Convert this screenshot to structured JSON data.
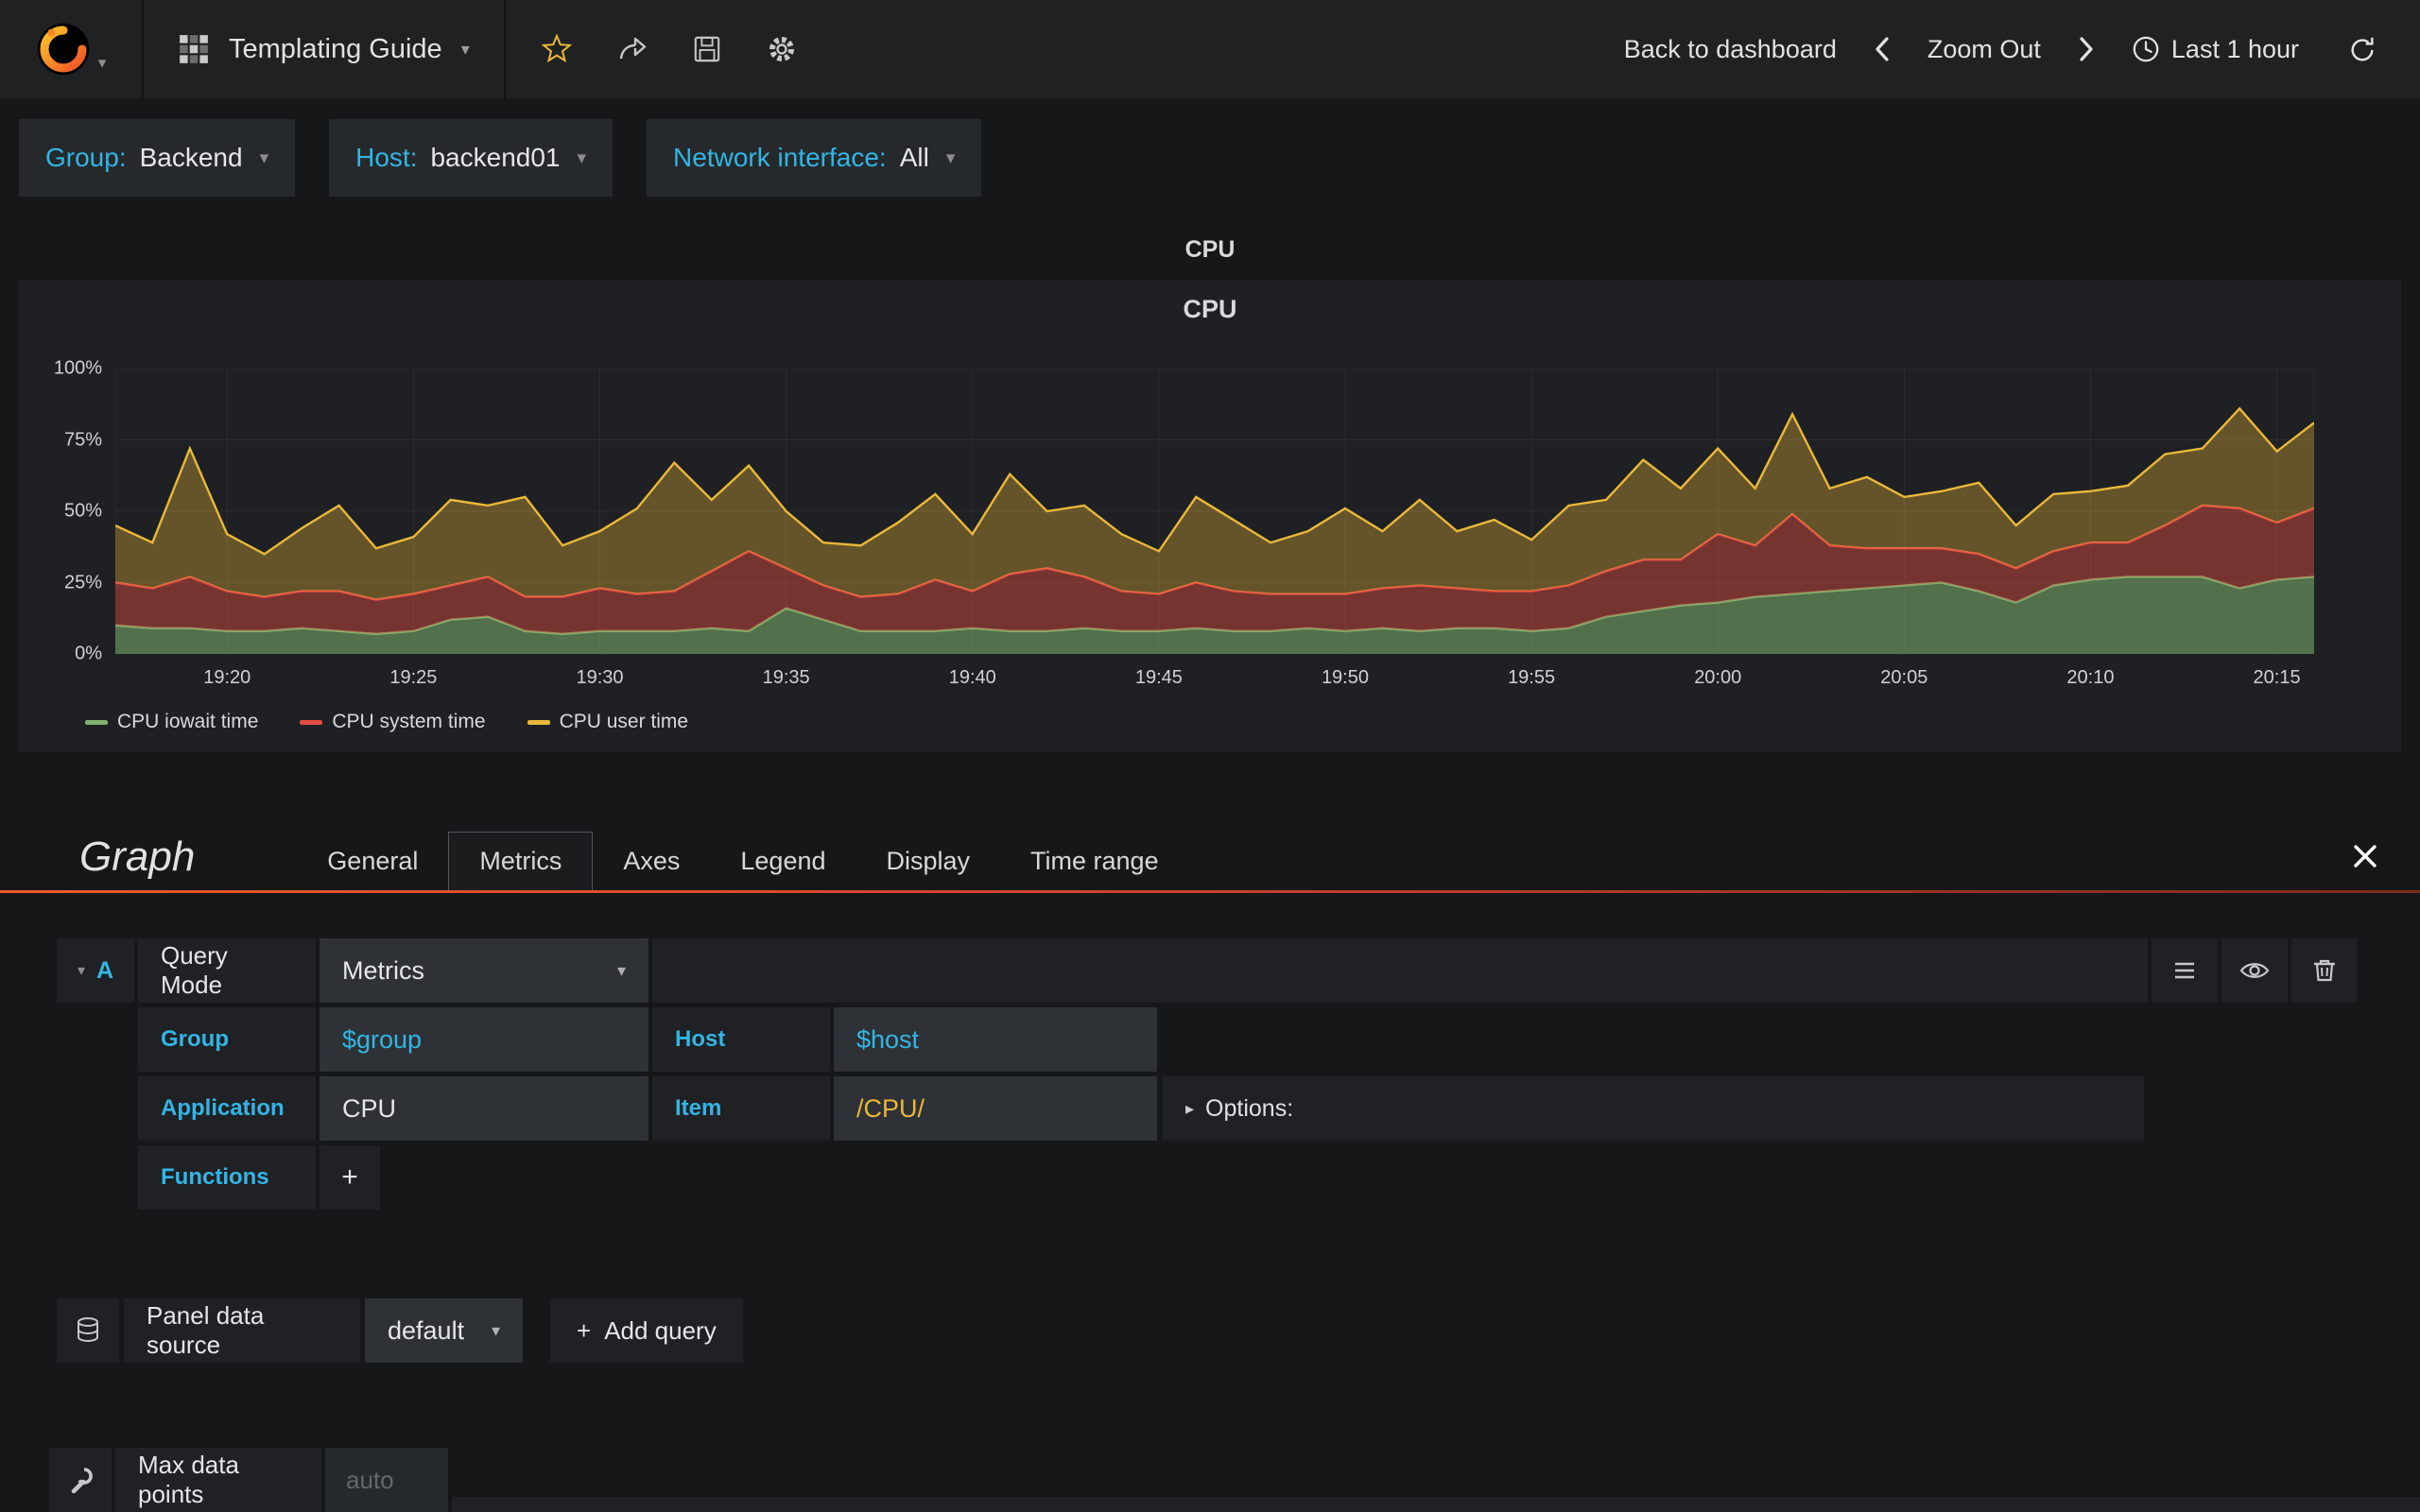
{
  "icons": {
    "caret_down": "▾",
    "caret_right": "▸",
    "plus": "+"
  },
  "navbar": {
    "title": "Templating Guide",
    "back_to_dashboard": "Back to dashboard",
    "zoom_out": "Zoom Out",
    "time_range": "Last 1 hour"
  },
  "variables": [
    {
      "label": "Group:",
      "value": "Backend"
    },
    {
      "label": "Host:",
      "value": "backend01"
    },
    {
      "label": "Network interface:",
      "value": "All"
    }
  ],
  "panel": {
    "fullscreen_title": "CPU",
    "graph_title": "CPU"
  },
  "chart_data": {
    "type": "area",
    "stacked": true,
    "title": "CPU",
    "unit": "percent",
    "ylim": [
      0,
      100
    ],
    "y_ticks": [
      "0%",
      "25%",
      "50%",
      "75%",
      "100%"
    ],
    "x_ticks": [
      "19:20",
      "19:25",
      "19:30",
      "19:35",
      "19:40",
      "19:45",
      "19:50",
      "19:55",
      "20:00",
      "20:05",
      "20:10",
      "20:15"
    ],
    "x_tick_minutes": [
      3,
      8,
      13,
      18,
      23,
      28,
      33,
      38,
      43,
      48,
      53,
      58
    ],
    "x_span_minutes": 59,
    "x_start": "19:17",
    "x_end": "20:16",
    "grid": true,
    "legend_position": "bottom-left",
    "series": [
      {
        "name": "CPU iowait time",
        "color": "#7eb26d",
        "fill": "rgba(126,178,109,0.55)",
        "values": [
          10,
          9,
          9,
          8,
          8,
          9,
          8,
          7,
          8,
          12,
          13,
          8,
          7,
          8,
          8,
          8,
          9,
          8,
          16,
          12,
          8,
          8,
          8,
          9,
          8,
          8,
          9,
          8,
          8,
          9,
          8,
          8,
          9,
          8,
          9,
          8,
          9,
          9,
          8,
          9,
          13,
          15,
          17,
          18,
          20,
          21,
          22,
          23,
          24,
          25,
          22,
          18,
          24,
          26,
          27,
          27,
          27,
          23,
          26,
          27
        ]
      },
      {
        "name": "CPU system time",
        "color": "#e24d42",
        "fill": "rgba(226,77,66,0.45)",
        "values": [
          15,
          14,
          18,
          14,
          12,
          13,
          14,
          12,
          13,
          12,
          14,
          12,
          13,
          15,
          13,
          14,
          20,
          28,
          14,
          12,
          12,
          13,
          18,
          13,
          20,
          22,
          18,
          14,
          13,
          16,
          14,
          13,
          12,
          13,
          14,
          16,
          14,
          13,
          14,
          15,
          16,
          18,
          16,
          24,
          18,
          28,
          16,
          14,
          13,
          12,
          13,
          12,
          12,
          13,
          12,
          18,
          25,
          28,
          20,
          24
        ]
      },
      {
        "name": "CPU user time",
        "color": "#eab839",
        "fill": "rgba(234,184,57,0.35)",
        "values": [
          20,
          16,
          45,
          20,
          15,
          22,
          30,
          18,
          20,
          30,
          25,
          35,
          18,
          20,
          30,
          45,
          25,
          30,
          20,
          15,
          18,
          25,
          30,
          20,
          35,
          20,
          25,
          20,
          15,
          30,
          25,
          18,
          22,
          30,
          20,
          30,
          20,
          25,
          18,
          28,
          25,
          35,
          25,
          30,
          20,
          35,
          20,
          25,
          18,
          20,
          25,
          15,
          20,
          18,
          20,
          25,
          20,
          35,
          25,
          30
        ]
      }
    ]
  },
  "editor": {
    "panel_type": "Graph",
    "tabs": [
      "General",
      "Metrics",
      "Axes",
      "Legend",
      "Display",
      "Time range"
    ],
    "active_tab": "Metrics",
    "query": {
      "ref_id": "A",
      "query_mode_label": "Query Mode",
      "query_mode_value": "Metrics",
      "group_label": "Group",
      "group_value": "$group",
      "host_label": "Host",
      "host_value": "$host",
      "application_label": "Application",
      "application_value": "CPU",
      "item_label": "Item",
      "item_value": "/CPU/",
      "options_label": "Options:",
      "functions_label": "Functions",
      "add_function": "+"
    },
    "datasource": {
      "label": "Panel data source",
      "value": "default",
      "add_query": "Add query"
    },
    "max_data_points": {
      "label": "Max data points",
      "placeholder": "auto"
    }
  },
  "colors": {
    "accent": "#33b5e5",
    "item_value": "#eab839",
    "background": "#161719",
    "panel_bg": "#1e2023",
    "box_bg": "#1f2124",
    "input_bg": "#2e3136",
    "tab_line_start": "#f05a28",
    "tab_line_end": "#7e2a1a"
  }
}
